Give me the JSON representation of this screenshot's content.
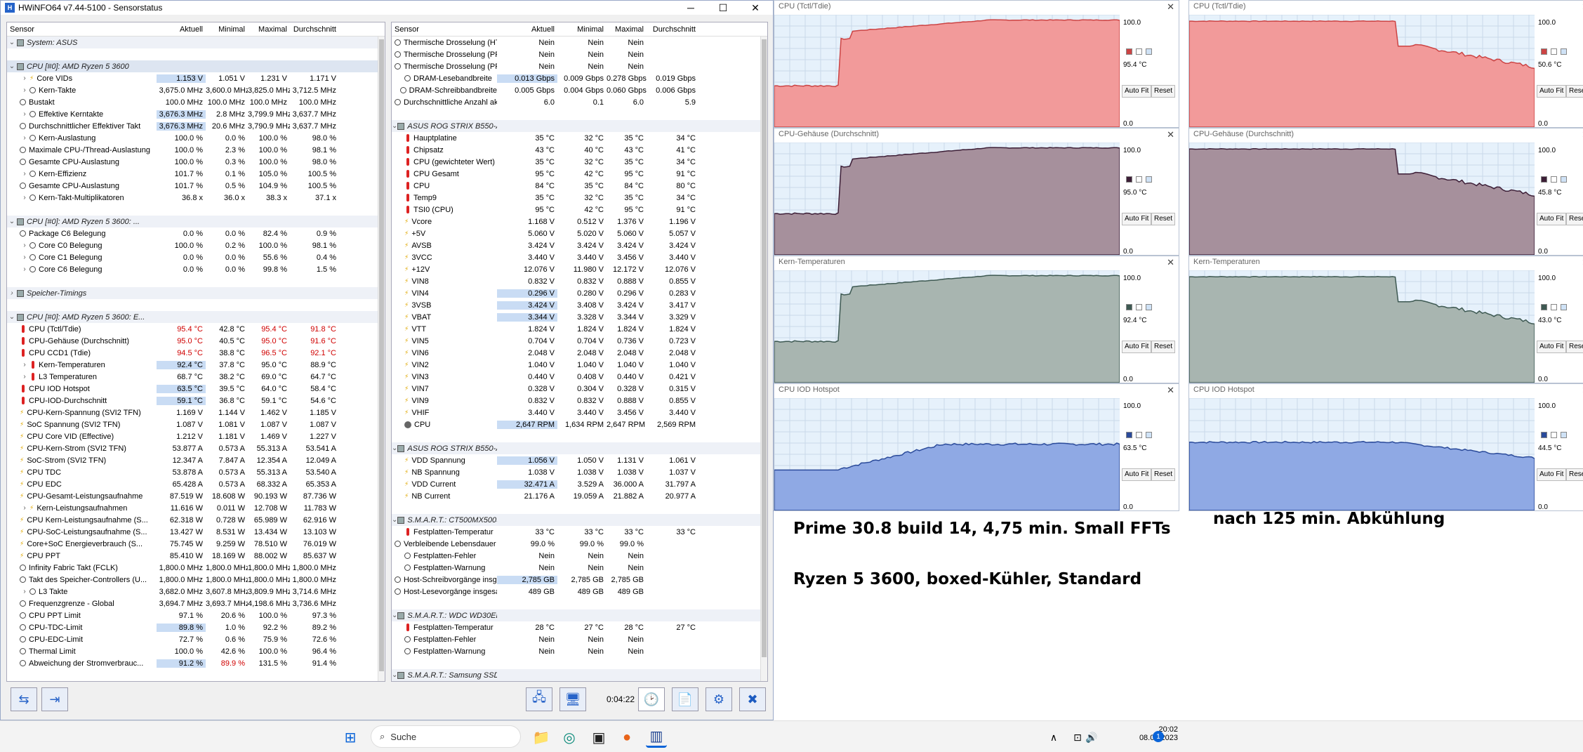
{
  "window": {
    "title": "HWiNFO64 v7.44-5100 - Sensorstatus",
    "minimize": "─",
    "maximize": "☐",
    "close": "✕"
  },
  "left_headers": [
    "Sensor",
    "Aktuell",
    "Minimal",
    "Maximal",
    "Durchschnitt"
  ],
  "right_headers": [
    "Sensor",
    "Aktuell",
    "Minimal",
    "Maximal",
    "Durchschnitt"
  ],
  "left_rows": [
    {
      "t": "grp",
      "n": "System: ASUS"
    },
    {
      "t": "gap"
    },
    {
      "t": "grp",
      "n": "CPU [#0]: AMD Ryzen 5 3600",
      "sel": true
    },
    {
      "n": "Core VIDs",
      "ex": ">",
      "i": "bolt",
      "d": 1,
      "v": [
        "1.153 V",
        "1.051 V",
        "1.231 V",
        "1.171 V"
      ],
      "h": [
        0
      ]
    },
    {
      "n": "Kern-Takte",
      "ex": ">",
      "i": "clock",
      "d": 1,
      "v": [
        "3,675.0 MHz",
        "3,600.0 MHz",
        "3,825.0 MHz",
        "3,712.5 MHz"
      ]
    },
    {
      "n": "Bustakt",
      "i": "clock",
      "v": [
        "100.0 MHz",
        "100.0 MHz",
        "100.0 MHz",
        "100.0 MHz"
      ]
    },
    {
      "n": "Effektive Kerntakte",
      "ex": ">",
      "i": "clock",
      "d": 1,
      "v": [
        "3,676.3 MHz",
        "2.8 MHz",
        "3,799.9 MHz",
        "3,637.7 MHz"
      ],
      "h": [
        0
      ]
    },
    {
      "n": "Durchschnittlicher Effektiver Takt",
      "i": "clock",
      "v": [
        "3,676.3 MHz",
        "20.6 MHz",
        "3,790.9 MHz",
        "3,637.7 MHz"
      ],
      "h": [
        0
      ]
    },
    {
      "n": "Kern-Auslastung",
      "ex": ">",
      "i": "clock",
      "d": 1,
      "v": [
        "100.0 %",
        "0.0 %",
        "100.0 %",
        "98.0 %"
      ]
    },
    {
      "n": "Maximale CPU-/Thread-Auslastung",
      "i": "clock",
      "v": [
        "100.0 %",
        "2.3 %",
        "100.0 %",
        "98.1 %"
      ]
    },
    {
      "n": "Gesamte CPU-Auslastung",
      "i": "clock",
      "v": [
        "100.0 %",
        "0.3 %",
        "100.0 %",
        "98.0 %"
      ]
    },
    {
      "n": "Kern-Effizienz",
      "ex": ">",
      "i": "clock",
      "d": 1,
      "v": [
        "101.7 %",
        "0.1 %",
        "105.0 %",
        "100.5 %"
      ]
    },
    {
      "n": "Gesamte CPU-Auslastung",
      "i": "clock",
      "v": [
        "101.7 %",
        "0.5 %",
        "104.9 %",
        "100.5 %"
      ]
    },
    {
      "n": "Kern-Takt-Multiplikatoren",
      "ex": ">",
      "i": "clock",
      "d": 1,
      "v": [
        "36.8 x",
        "36.0 x",
        "38.3 x",
        "37.1 x"
      ]
    },
    {
      "t": "gap"
    },
    {
      "t": "grp",
      "n": "CPU [#0]: AMD Ryzen 5 3600: ..."
    },
    {
      "n": "Package C6 Belegung",
      "i": "clock",
      "v": [
        "0.0 %",
        "0.0 %",
        "82.4 %",
        "0.9 %"
      ]
    },
    {
      "n": "Core C0 Belegung",
      "ex": ">",
      "i": "clock",
      "d": 1,
      "v": [
        "100.0 %",
        "0.2 %",
        "100.0 %",
        "98.1 %"
      ]
    },
    {
      "n": "Core C1 Belegung",
      "ex": ">",
      "i": "clock",
      "d": 1,
      "v": [
        "0.0 %",
        "0.0 %",
        "55.6 %",
        "0.4 %"
      ]
    },
    {
      "n": "Core C6 Belegung",
      "ex": ">",
      "i": "clock",
      "d": 1,
      "v": [
        "0.0 %",
        "0.0 %",
        "99.8 %",
        "1.5 %"
      ]
    },
    {
      "t": "gap"
    },
    {
      "t": "grp",
      "n": "Speicher-Timings",
      "ex": ">"
    },
    {
      "t": "gap"
    },
    {
      "t": "grp",
      "n": "CPU [#0]: AMD Ryzen 5 3600: E..."
    },
    {
      "n": "CPU (Tctl/Tdie)",
      "i": "therm",
      "v": [
        "95.4 °C",
        "42.8 °C",
        "95.4 °C",
        "91.8 °C"
      ],
      "r": [
        0,
        2,
        3
      ]
    },
    {
      "n": "CPU-Gehäuse (Durchschnitt)",
      "i": "therm",
      "v": [
        "95.0 °C",
        "40.5 °C",
        "95.0 °C",
        "91.6 °C"
      ],
      "r": [
        0,
        2,
        3
      ]
    },
    {
      "n": "CPU CCD1 (Tdie)",
      "i": "therm",
      "v": [
        "94.5 °C",
        "38.8 °C",
        "96.5 °C",
        "92.1 °C"
      ],
      "r": [
        0,
        2,
        3
      ]
    },
    {
      "n": "Kern-Temperaturen",
      "ex": ">",
      "i": "therm",
      "d": 1,
      "v": [
        "92.4 °C",
        "37.8 °C",
        "95.0 °C",
        "88.9 °C"
      ],
      "h": [
        0
      ]
    },
    {
      "n": "L3 Temperaturen",
      "ex": ">",
      "i": "therm",
      "d": 1,
      "v": [
        "68.7 °C",
        "38.2 °C",
        "69.0 °C",
        "64.7 °C"
      ]
    },
    {
      "n": "CPU IOD Hotspot",
      "i": "therm",
      "v": [
        "63.5 °C",
        "39.5 °C",
        "64.0 °C",
        "58.4 °C"
      ],
      "h": [
        0
      ]
    },
    {
      "n": "CPU-IOD-Durchschnitt",
      "i": "therm",
      "v": [
        "59.1 °C",
        "36.8 °C",
        "59.1 °C",
        "54.6 °C"
      ],
      "h": [
        0
      ]
    },
    {
      "n": "CPU-Kern-Spannung (SVI2 TFN)",
      "i": "bolt",
      "v": [
        "1.169 V",
        "1.144 V",
        "1.462 V",
        "1.185 V"
      ]
    },
    {
      "n": "SoC Spannung (SVI2 TFN)",
      "i": "bolt",
      "v": [
        "1.087 V",
        "1.081 V",
        "1.087 V",
        "1.087 V"
      ]
    },
    {
      "n": "CPU Core VID (Effective)",
      "i": "bolt",
      "v": [
        "1.212 V",
        "1.181 V",
        "1.469 V",
        "1.227 V"
      ]
    },
    {
      "n": "CPU-Kern-Strom (SVI2 TFN)",
      "i": "bolt",
      "v": [
        "53.877 A",
        "0.573 A",
        "55.313 A",
        "53.541 A"
      ]
    },
    {
      "n": "SoC-Strom (SVI2 TFN)",
      "i": "bolt",
      "v": [
        "12.347 A",
        "7.847 A",
        "12.354 A",
        "12.049 A"
      ]
    },
    {
      "n": "CPU TDC",
      "i": "bolt",
      "v": [
        "53.878 A",
        "0.573 A",
        "55.313 A",
        "53.540 A"
      ]
    },
    {
      "n": "CPU EDC",
      "i": "bolt",
      "v": [
        "65.428 A",
        "0.573 A",
        "68.332 A",
        "65.353 A"
      ]
    },
    {
      "n": "CPU-Gesamt-Leistungsaufnahme",
      "i": "bolt",
      "v": [
        "87.519 W",
        "18.608 W",
        "90.193 W",
        "87.736 W"
      ]
    },
    {
      "n": "Kern-Leistungsaufnahmen",
      "ex": ">",
      "i": "bolt",
      "d": 1,
      "v": [
        "11.616 W",
        "0.011 W",
        "12.708 W",
        "11.783 W"
      ]
    },
    {
      "n": "CPU Kern-Leistungsaufnahme (S...",
      "i": "bolt",
      "v": [
        "62.318 W",
        "0.728 W",
        "65.989 W",
        "62.916 W"
      ]
    },
    {
      "n": "CPU-SoC-Leistungsaufnahme (S...",
      "i": "bolt",
      "v": [
        "13.427 W",
        "8.531 W",
        "13.434 W",
        "13.103 W"
      ]
    },
    {
      "n": "Core+SoC Energieverbrauch (S...",
      "i": "bolt",
      "v": [
        "75.745 W",
        "9.259 W",
        "78.510 W",
        "76.019 W"
      ]
    },
    {
      "n": "CPU PPT",
      "i": "bolt",
      "v": [
        "85.410 W",
        "18.169 W",
        "88.002 W",
        "85.637 W"
      ]
    },
    {
      "n": "Infinity Fabric Takt (FCLK)",
      "i": "clock",
      "v": [
        "1,800.0 MHz",
        "1,800.0 MHz",
        "1,800.0 MHz",
        "1,800.0 MHz"
      ]
    },
    {
      "n": "Takt des Speicher-Controllers (U...",
      "i": "clock",
      "v": [
        "1,800.0 MHz",
        "1,800.0 MHz",
        "1,800.0 MHz",
        "1,800.0 MHz"
      ]
    },
    {
      "n": "L3 Takte",
      "ex": ">",
      "i": "clock",
      "d": 1,
      "v": [
        "3,682.0 MHz",
        "3,607.8 MHz",
        "3,809.9 MHz",
        "3,714.6 MHz"
      ]
    },
    {
      "n": "Frequenzgrenze - Global",
      "i": "clock",
      "v": [
        "3,694.7 MHz",
        "3,693.7 MHz",
        "4,198.6 MHz",
        "3,736.6 MHz"
      ]
    },
    {
      "n": "CPU PPT Limit",
      "i": "clock",
      "v": [
        "97.1 %",
        "20.6 %",
        "100.0 %",
        "97.3 %"
      ]
    },
    {
      "n": "CPU-TDC-Limit",
      "i": "clock",
      "v": [
        "89.8 %",
        "1.0 %",
        "92.2 %",
        "89.2 %"
      ],
      "h": [
        0
      ]
    },
    {
      "n": "CPU-EDC-Limit",
      "i": "clock",
      "v": [
        "72.7 %",
        "0.6 %",
        "75.9 %",
        "72.6 %"
      ]
    },
    {
      "n": "Thermal Limit",
      "i": "clock",
      "v": [
        "100.0 %",
        "42.6 %",
        "100.0 %",
        "96.4 %"
      ]
    },
    {
      "n": "Abweichung der Stromverbrauc...",
      "i": "clock",
      "v": [
        "91.2 %",
        "89.9 %",
        "131.5 %",
        "91.4 %"
      ],
      "h": [
        0
      ],
      "r": [
        1
      ]
    }
  ],
  "right_rows": [
    {
      "n": "Thermische Drosselung (HTC)",
      "i": "clock",
      "v": [
        "Nein",
        "Nein",
        "Nein",
        ""
      ]
    },
    {
      "n": "Thermische Drosselung (PROC...",
      "i": "clock",
      "v": [
        "Nein",
        "Nein",
        "Nein",
        ""
      ]
    },
    {
      "n": "Thermische Drosselung (PROC...",
      "i": "clock",
      "v": [
        "Nein",
        "Nein",
        "Nein",
        ""
      ]
    },
    {
      "n": "DRAM-Lesebandbreite",
      "i": "clock",
      "v": [
        "0.013 Gbps",
        "0.009 Gbps",
        "0.278 Gbps",
        "0.019 Gbps"
      ],
      "h": [
        0
      ]
    },
    {
      "n": "DRAM-Schreibbandbreite",
      "i": "clock",
      "v": [
        "0.005 Gbps",
        "0.004 Gbps",
        "0.060 Gbps",
        "0.006 Gbps"
      ]
    },
    {
      "n": "Durchschnittliche Anzahl aktiv...",
      "i": "clock",
      "v": [
        "6.0",
        "0.1",
        "6.0",
        "5.9"
      ]
    },
    {
      "t": "gap"
    },
    {
      "t": "grp",
      "n": "ASUS ROG STRIX B550-A GA...",
      "ex": "v"
    },
    {
      "n": "Hauptplatine",
      "i": "therm",
      "v": [
        "35 °C",
        "32 °C",
        "35 °C",
        "34 °C"
      ]
    },
    {
      "n": "Chipsatz",
      "i": "therm",
      "v": [
        "43 °C",
        "40 °C",
        "43 °C",
        "41 °C"
      ]
    },
    {
      "n": "CPU (gewichteter Wert)",
      "i": "therm",
      "v": [
        "35 °C",
        "32 °C",
        "35 °C",
        "34 °C"
      ]
    },
    {
      "n": "CPU Gesamt",
      "i": "therm",
      "v": [
        "95 °C",
        "42 °C",
        "95 °C",
        "91 °C"
      ]
    },
    {
      "n": "CPU",
      "i": "therm",
      "v": [
        "84 °C",
        "35 °C",
        "84 °C",
        "80 °C"
      ]
    },
    {
      "n": "Temp9",
      "i": "therm",
      "v": [
        "35 °C",
        "32 °C",
        "35 °C",
        "34 °C"
      ]
    },
    {
      "n": "TSI0 (CPU)",
      "i": "therm",
      "v": [
        "95 °C",
        "42 °C",
        "95 °C",
        "91 °C"
      ]
    },
    {
      "n": "Vcore",
      "i": "bolt",
      "v": [
        "1.168 V",
        "0.512 V",
        "1.376 V",
        "1.196 V"
      ]
    },
    {
      "n": "+5V",
      "i": "bolt",
      "v": [
        "5.060 V",
        "5.020 V",
        "5.060 V",
        "5.057 V"
      ]
    },
    {
      "n": "AVSB",
      "i": "bolt",
      "v": [
        "3.424 V",
        "3.424 V",
        "3.424 V",
        "3.424 V"
      ]
    },
    {
      "n": "3VCC",
      "i": "bolt",
      "v": [
        "3.440 V",
        "3.440 V",
        "3.456 V",
        "3.440 V"
      ]
    },
    {
      "n": "+12V",
      "i": "bolt",
      "v": [
        "12.076 V",
        "11.980 V",
        "12.172 V",
        "12.076 V"
      ]
    },
    {
      "n": "VIN8",
      "i": "bolt",
      "v": [
        "0.832 V",
        "0.832 V",
        "0.888 V",
        "0.855 V"
      ]
    },
    {
      "n": "VIN4",
      "i": "bolt",
      "v": [
        "0.296 V",
        "0.280 V",
        "0.296 V",
        "0.283 V"
      ],
      "h": [
        0
      ]
    },
    {
      "n": "3VSB",
      "i": "bolt",
      "v": [
        "3.424 V",
        "3.408 V",
        "3.424 V",
        "3.417 V"
      ],
      "h": [
        0
      ]
    },
    {
      "n": "VBAT",
      "i": "bolt",
      "v": [
        "3.344 V",
        "3.328 V",
        "3.344 V",
        "3.329 V"
      ],
      "h": [
        0
      ]
    },
    {
      "n": "VTT",
      "i": "bolt",
      "v": [
        "1.824 V",
        "1.824 V",
        "1.824 V",
        "1.824 V"
      ]
    },
    {
      "n": "VIN5",
      "i": "bolt",
      "v": [
        "0.704 V",
        "0.704 V",
        "0.736 V",
        "0.723 V"
      ]
    },
    {
      "n": "VIN6",
      "i": "bolt",
      "v": [
        "2.048 V",
        "2.048 V",
        "2.048 V",
        "2.048 V"
      ]
    },
    {
      "n": "VIN2",
      "i": "bolt",
      "v": [
        "1.040 V",
        "1.040 V",
        "1.040 V",
        "1.040 V"
      ]
    },
    {
      "n": "VIN3",
      "i": "bolt",
      "v": [
        "0.440 V",
        "0.408 V",
        "0.440 V",
        "0.421 V"
      ]
    },
    {
      "n": "VIN7",
      "i": "bolt",
      "v": [
        "0.328 V",
        "0.304 V",
        "0.328 V",
        "0.315 V"
      ]
    },
    {
      "n": "VIN9",
      "i": "bolt",
      "v": [
        "0.832 V",
        "0.832 V",
        "0.888 V",
        "0.855 V"
      ]
    },
    {
      "n": "VHIF",
      "i": "bolt",
      "v": [
        "3.440 V",
        "3.440 V",
        "3.456 V",
        "3.440 V"
      ]
    },
    {
      "n": "CPU",
      "i": "fan",
      "v": [
        "2,647 RPM",
        "1,634 RPM",
        "2,647 RPM",
        "2,569 RPM"
      ],
      "h": [
        0
      ]
    },
    {
      "t": "gap"
    },
    {
      "t": "grp",
      "n": "ASUS ROG STRIX B550-A GA...",
      "ex": "v"
    },
    {
      "n": "VDD Spannung",
      "i": "bolt",
      "v": [
        "1.056 V",
        "1.050 V",
        "1.131 V",
        "1.061 V"
      ],
      "h": [
        0
      ]
    },
    {
      "n": "NB Spannung",
      "i": "bolt",
      "v": [
        "1.038 V",
        "1.038 V",
        "1.038 V",
        "1.037 V"
      ]
    },
    {
      "n": "VDD Current",
      "i": "bolt",
      "v": [
        "32.471 A",
        "3.529 A",
        "36.000 A",
        "31.797 A"
      ],
      "h": [
        0
      ]
    },
    {
      "n": "NB Current",
      "i": "bolt",
      "v": [
        "21.176 A",
        "19.059 A",
        "21.882 A",
        "20.977 A"
      ]
    },
    {
      "t": "gap"
    },
    {
      "t": "grp",
      "n": "S.M.A.R.T.: CT500MX500SSD...",
      "ex": "v"
    },
    {
      "n": "Festplatten-Temperatur",
      "i": "therm",
      "v": [
        "33 °C",
        "33 °C",
        "33 °C",
        "33 °C"
      ]
    },
    {
      "n": "Verbleibende Lebensdauer de...",
      "i": "clock",
      "v": [
        "99.0 %",
        "99.0 %",
        "99.0 %",
        ""
      ]
    },
    {
      "n": "Festplatten-Fehler",
      "i": "clock",
      "v": [
        "Nein",
        "Nein",
        "Nein",
        ""
      ]
    },
    {
      "n": "Festplatten-Warnung",
      "i": "clock",
      "v": [
        "Nein",
        "Nein",
        "Nein",
        ""
      ]
    },
    {
      "n": "Host-Schreibvorgänge insges...",
      "i": "clock",
      "v": [
        "2,785 GB",
        "2,785 GB",
        "2,785 GB",
        ""
      ],
      "h": [
        0
      ]
    },
    {
      "n": "Host-Lesevorgänge insgesamt",
      "i": "clock",
      "v": [
        "489 GB",
        "489 GB",
        "489 GB",
        ""
      ]
    },
    {
      "t": "gap"
    },
    {
      "t": "grp",
      "n": "S.M.A.R.T.: WDC WD30EFRX...",
      "ex": "v"
    },
    {
      "n": "Festplatten-Temperatur",
      "i": "therm",
      "v": [
        "28 °C",
        "27 °C",
        "28 °C",
        "27 °C"
      ]
    },
    {
      "n": "Festplatten-Fehler",
      "i": "clock",
      "v": [
        "Nein",
        "Nein",
        "Nein",
        ""
      ]
    },
    {
      "n": "Festplatten-Warnung",
      "i": "clock",
      "v": [
        "Nein",
        "Nein",
        "Nein",
        ""
      ]
    },
    {
      "t": "gap"
    },
    {
      "t": "grp",
      "n": "S.M.A.R.T.: Samsung SSD 98...",
      "ex": "v"
    }
  ],
  "bottom": {
    "timer": "0:04:22"
  },
  "graphs_left": [
    {
      "title": "CPU (Tctl/Tdie)",
      "max": "100.0",
      "min": "0.0",
      "cur": "95.4 °C",
      "color": "#f29a9a",
      "line": "#c44",
      "profile": "load"
    },
    {
      "title": "CPU-Gehäuse (Durchschnitt)",
      "max": "100.0",
      "min": "0.0",
      "cur": "95.0 °C",
      "color": "#a6909c",
      "line": "#3c1e36",
      "profile": "load"
    },
    {
      "title": "Kern-Temperaturen",
      "max": "100.0",
      "min": "0.0",
      "cur": "92.4 °C",
      "color": "#a8b5b0",
      "line": "#3e5952",
      "profile": "load"
    },
    {
      "title": "CPU IOD Hotspot",
      "max": "100.0",
      "min": "0.0",
      "cur": "63.5 °C",
      "color": "#8fa9e4",
      "line": "#2a4a9a",
      "profile": "iod"
    }
  ],
  "graphs_right": [
    {
      "title": "CPU (Tctl/Tdie)",
      "max": "100.0",
      "min": "0.0",
      "cur": "50.6 °C",
      "color": "#f29a9a",
      "line": "#c44",
      "profile": "cool"
    },
    {
      "title": "CPU-Gehäuse (Durchschnitt)",
      "max": "100.0",
      "min": "0.0",
      "cur": "45.8 °C",
      "color": "#a6909c",
      "line": "#3c1e36",
      "profile": "cool"
    },
    {
      "title": "Kern-Temperaturen",
      "max": "100.0",
      "min": "0.0",
      "cur": "43.0 °C",
      "color": "#a8b5b0",
      "line": "#3e5952",
      "profile": "cool"
    },
    {
      "title": "CPU IOD Hotspot",
      "max": "100.0",
      "min": "0.0",
      "cur": "44.5 °C",
      "color": "#8fa9e4",
      "line": "#2a4a9a",
      "profile": "coolIod"
    }
  ],
  "graph_buttons": {
    "autofit": "Auto Fit",
    "reset": "Reset",
    "close": "✕"
  },
  "notes": {
    "line1": "Prime 30.8 build 14, 4,75 min. Small FFTs",
    "line2": "Ryzen 5 3600, boxed-Kühler, Standard",
    "line3": "nach 125 min. Abkühlung"
  },
  "taskbar": {
    "search": "Suche",
    "time": "20:02",
    "date": "08.05.2023",
    "badge": "1"
  }
}
